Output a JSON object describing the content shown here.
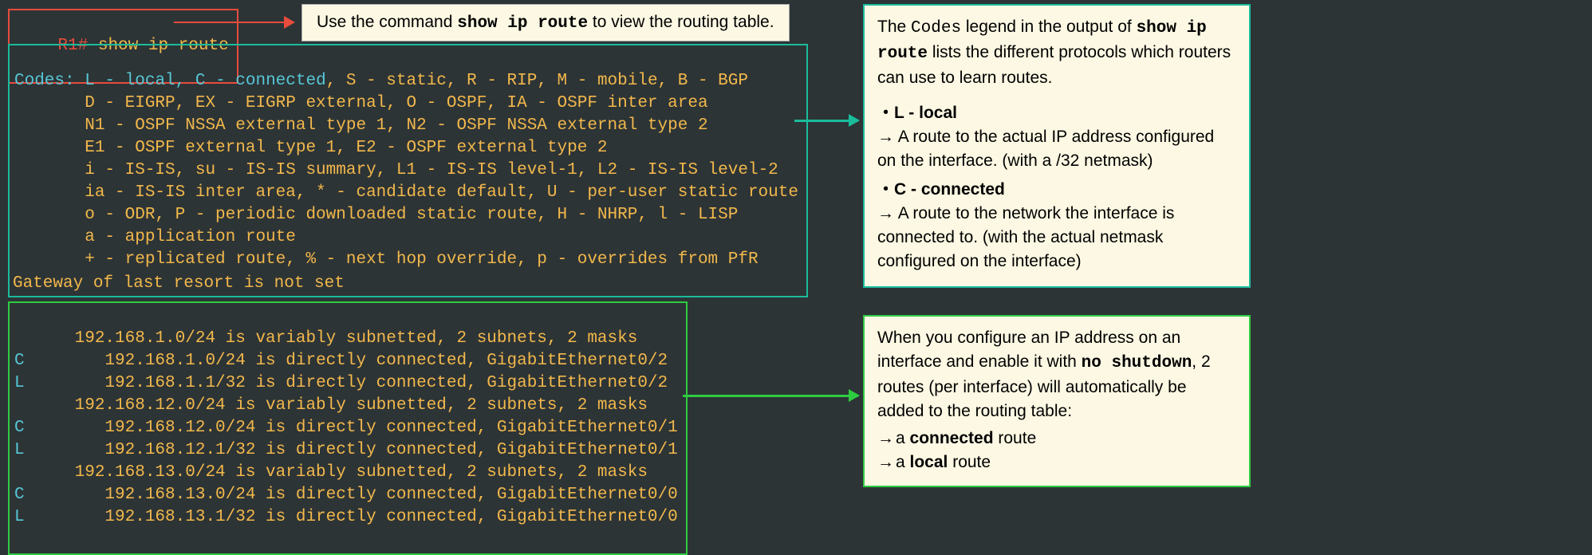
{
  "prompt": {
    "host": "R1#",
    "command": "show ip route"
  },
  "top_callout": {
    "pre": "Use the command ",
    "cmd": "show ip route",
    "post": " to view the routing table."
  },
  "codes": {
    "label": "Codes:",
    "l1a": " L - local",
    "l1b": ", C - connected",
    "l1c": ", S - static, R - RIP, M - mobile, B - BGP",
    "l2": "       D - EIGRP, EX - EIGRP external, O - OSPF, IA - OSPF inter area",
    "l3": "       N1 - OSPF NSSA external type 1, N2 - OSPF NSSA external type 2",
    "l4": "       E1 - OSPF external type 1, E2 - OSPF external type 2",
    "l5": "       i - IS-IS, su - IS-IS summary, L1 - IS-IS level-1, L2 - IS-IS level-2",
    "l6": "       ia - IS-IS inter area, * - candidate default, U - per-user static route",
    "l7": "       o - ODR, P - periodic downloaded static route, H - NHRP, l - LISP",
    "l8": "       a - application route",
    "l9": "       + - replicated route, % - next hop override, p - overrides from PfR"
  },
  "gateway": "Gateway of last resort is not set",
  "routes": {
    "r1": "      192.168.1.0/24 is variably subnetted, 2 subnets, 2 masks",
    "r2c": "C",
    "r2": "        192.168.1.0/24 is directly connected, GigabitEthernet0/2",
    "r3c": "L",
    "r3": "        192.168.1.1/32 is directly connected, GigabitEthernet0/2",
    "r4": "      192.168.12.0/24 is variably subnetted, 2 subnets, 2 masks",
    "r5c": "C",
    "r5": "        192.168.12.0/24 is directly connected, GigabitEthernet0/1",
    "r6c": "L",
    "r6": "        192.168.12.1/32 is directly connected, GigabitEthernet0/1",
    "r7": "      192.168.13.0/24 is variably subnetted, 2 subnets, 2 masks",
    "r8c": "C",
    "r8": "        192.168.13.0/24 is directly connected, GigabitEthernet0/0",
    "r9c": "L",
    "r9": "        192.168.13.1/32 is directly connected, GigabitEthernet0/0"
  },
  "rc1": {
    "intro_a": "The ",
    "intro_codes": "Codes",
    "intro_b": " legend in the output of ",
    "intro_cmd": "show ip route",
    "intro_c": " lists the different protocols which routers can use to learn routes.",
    "b1": "L - local",
    "b1sub": "A route to the actual IP address configured on the interface. (with a /32 netmask)",
    "b2": "C - connected",
    "b2sub": " A route to the network the interface is connected to. (with the actual netmask configured on the interface)"
  },
  "rc2": {
    "intro_a": "When you configure an IP address on an interface and enable it with ",
    "intro_cmd": "no shutdown",
    "intro_b": ", 2 routes (per interface) will automatically be added to the routing table:",
    "li1a": "a ",
    "li1b": "connected",
    "li1c": " route",
    "li2a": "a ",
    "li2b": "local",
    "li2c": " route"
  }
}
